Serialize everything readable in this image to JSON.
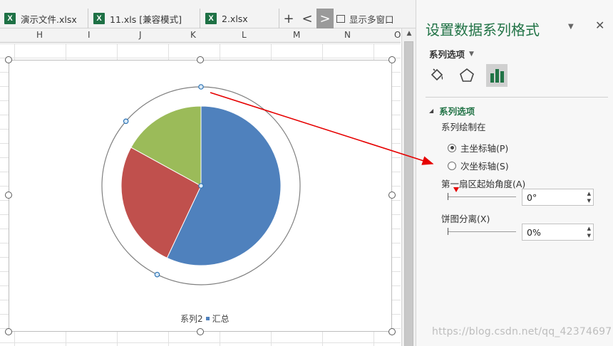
{
  "tabs": [
    {
      "label": "演示文件.xlsx"
    },
    {
      "label": "11.xls  [兼容模式]"
    },
    {
      "label": "2.xlsx"
    }
  ],
  "tabbar": {
    "new_tab_glyph": "+",
    "prev_glyph": "<",
    "next_glyph": ">",
    "multi_window_label": "显示多窗口"
  },
  "grid": {
    "columns": [
      "H",
      "I",
      "J",
      "K",
      "L",
      "M",
      "N",
      "O"
    ]
  },
  "chart_data": {
    "type": "pie",
    "categories": [
      "",
      "",
      ""
    ],
    "values": [
      57,
      26,
      17
    ],
    "colors": [
      "#4f81bd",
      "#c0504d",
      "#9bbb59"
    ],
    "legend": {
      "entries": [
        "系列2",
        "汇总"
      ],
      "placement": "bottom"
    },
    "first_slice_angle_deg": 0,
    "explosion_pct": 0
  },
  "panel": {
    "title": "设置数据系列格式",
    "options_label": "系列选项",
    "section_title": "系列选项",
    "plot_on_label": "系列绘制在",
    "primary_axis_label": "主坐标轴(P)",
    "secondary_axis_label": "次坐标轴(S)",
    "angle_label": "第一扇区起始角度(A)",
    "angle_value": "0°",
    "explosion_label": "饼图分离(X)",
    "explosion_value": "0%",
    "primary_selected": true,
    "close_glyph": "✕",
    "dropdown_glyph": "▼"
  },
  "watermark": "https://blog.csdn.net/qq_42374697",
  "icons": [
    "excel-file-icon",
    "paint-bucket-icon",
    "pentagon-icon",
    "bar-chart-icon",
    "window-icon"
  ]
}
